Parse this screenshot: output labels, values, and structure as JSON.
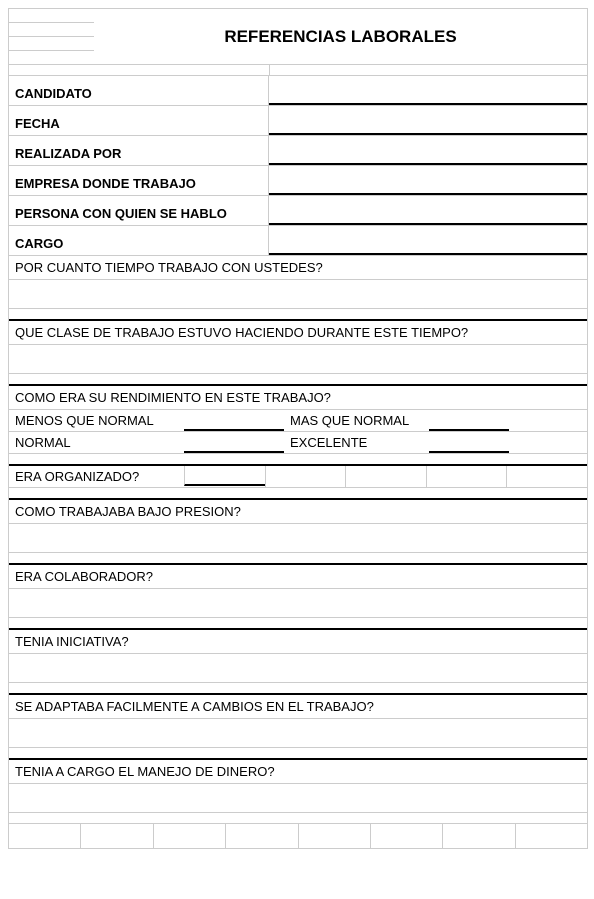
{
  "title": "REFERENCIAS LABORALES",
  "fields": {
    "candidato": "CANDIDATO",
    "fecha": "FECHA",
    "realizada_por": "REALIZADA POR",
    "empresa": "EMPRESA DONDE TRABAJO",
    "persona": "PERSONA CON QUIEN SE HABLO",
    "cargo": "CARGO"
  },
  "questions": {
    "q1": "POR CUANTO TIEMPO TRABAJO CON USTEDES?",
    "q2": "QUE CLASE DE TRABAJO ESTUVO HACIENDO DURANTE ESTE TIEMPO?",
    "q3": "COMO ERA SU RENDIMIENTO EN ESTE TRABAJO?",
    "q4": "ERA ORGANIZADO?",
    "q5": "COMO TRABAJABA BAJO PRESION?",
    "q6": "ERA COLABORADOR?",
    "q7": "TENIA INICIATIVA?",
    "q8": "SE ADAPTABA FACILMENTE A CAMBIOS EN EL TRABAJO?",
    "q9": "TENIA A CARGO EL MANEJO DE DINERO?"
  },
  "ratings": {
    "menos": "MENOS QUE NORMAL",
    "mas": "MAS QUE NORMAL",
    "normal": "NORMAL",
    "excelente": "EXCELENTE"
  }
}
